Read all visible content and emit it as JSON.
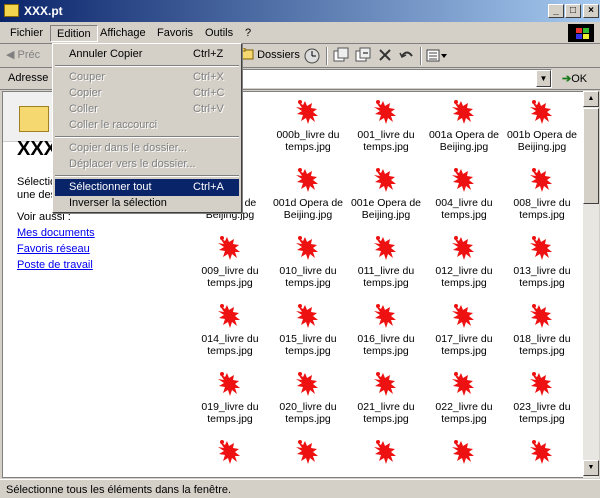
{
  "window": {
    "title": "XXX.pt"
  },
  "titlebar_buttons": {
    "min": "_",
    "max": "□",
    "close": "×"
  },
  "menubar": {
    "items": [
      {
        "label": "Fichier"
      },
      {
        "label": "Edition"
      },
      {
        "label": "Affichage"
      },
      {
        "label": "Favoris"
      },
      {
        "label": "Outils"
      },
      {
        "label": "?"
      }
    ]
  },
  "toolbar": {
    "back_label": "Préc",
    "folders_label": "Dossiers"
  },
  "addressbar": {
    "label": "Adresse",
    "go_label": "OK"
  },
  "edit_menu": {
    "items": [
      {
        "label": "Annuler Copier",
        "shortcut": "Ctrl+Z",
        "enabled": true
      },
      {
        "label": "Couper",
        "shortcut": "Ctrl+X",
        "enabled": false
      },
      {
        "label": "Copier",
        "shortcut": "Ctrl+C",
        "enabled": false
      },
      {
        "label": "Coller",
        "shortcut": "Ctrl+V",
        "enabled": false
      },
      {
        "label": "Coller le raccourci",
        "shortcut": "",
        "enabled": false
      },
      {
        "label": "Copier dans le dossier...",
        "shortcut": "",
        "enabled": false
      },
      {
        "label": "Déplacer vers le dossier...",
        "shortcut": "",
        "enabled": false
      },
      {
        "label": "Sélectionner tout",
        "shortcut": "Ctrl+A",
        "enabled": true,
        "highlighted": true
      },
      {
        "label": "Inverser la sélection",
        "shortcut": "",
        "enabled": true
      }
    ]
  },
  "left_pane": {
    "title": "XXX",
    "selection_line1": "Sélection",
    "selection_line2": "une des",
    "see_also": "Voir aussi :",
    "links": [
      "Mes documents",
      "Favoris réseau",
      "Poste de travail"
    ]
  },
  "files": [
    {
      "line1": "",
      "line2": ".jpg"
    },
    {
      "line1": "000b_livre du",
      "line2": "temps.jpg"
    },
    {
      "line1": "001_livre du",
      "line2": "temps.jpg"
    },
    {
      "line1": "001a Opera de",
      "line2": "Beijing.jpg"
    },
    {
      "line1": "001b Opera de",
      "line2": "Beijing.jpg"
    },
    {
      "line1": "a Opera de",
      "line2": "Beijing.jpg"
    },
    {
      "line1": "001d Opera de",
      "line2": "Beijing.jpg"
    },
    {
      "line1": "001e Opera de",
      "line2": "Beijing.jpg"
    },
    {
      "line1": "004_livre du",
      "line2": "temps.jpg"
    },
    {
      "line1": "008_livre du",
      "line2": "temps.jpg"
    },
    {
      "line1": "009_livre du",
      "line2": "temps.jpg"
    },
    {
      "line1": "010_livre du",
      "line2": "temps.jpg"
    },
    {
      "line1": "011_livre du",
      "line2": "temps.jpg"
    },
    {
      "line1": "012_livre du",
      "line2": "temps.jpg"
    },
    {
      "line1": "013_livre du",
      "line2": "temps.jpg"
    },
    {
      "line1": "014_livre du",
      "line2": "temps.jpg"
    },
    {
      "line1": "015_livre du",
      "line2": "temps.jpg"
    },
    {
      "line1": "016_livre du",
      "line2": "temps.jpg"
    },
    {
      "line1": "017_livre du",
      "line2": "temps.jpg"
    },
    {
      "line1": "018_livre du",
      "line2": "temps.jpg"
    },
    {
      "line1": "019_livre du",
      "line2": "temps.jpg"
    },
    {
      "line1": "020_livre du",
      "line2": "temps.jpg"
    },
    {
      "line1": "021_livre du",
      "line2": "temps.jpg"
    },
    {
      "line1": "022_livre du",
      "line2": "temps.jpg"
    },
    {
      "line1": "023_livre du",
      "line2": "temps.jpg"
    },
    {
      "line1": "",
      "line2": ""
    },
    {
      "line1": "",
      "line2": ""
    },
    {
      "line1": "",
      "line2": ""
    },
    {
      "line1": "",
      "line2": ""
    },
    {
      "line1": "",
      "line2": ""
    }
  ],
  "file_icon": {
    "name": "red-lizard-icon",
    "color": "#ee1111"
  },
  "statusbar": {
    "text": "Sélectionne tous les éléments dans la fenêtre."
  }
}
